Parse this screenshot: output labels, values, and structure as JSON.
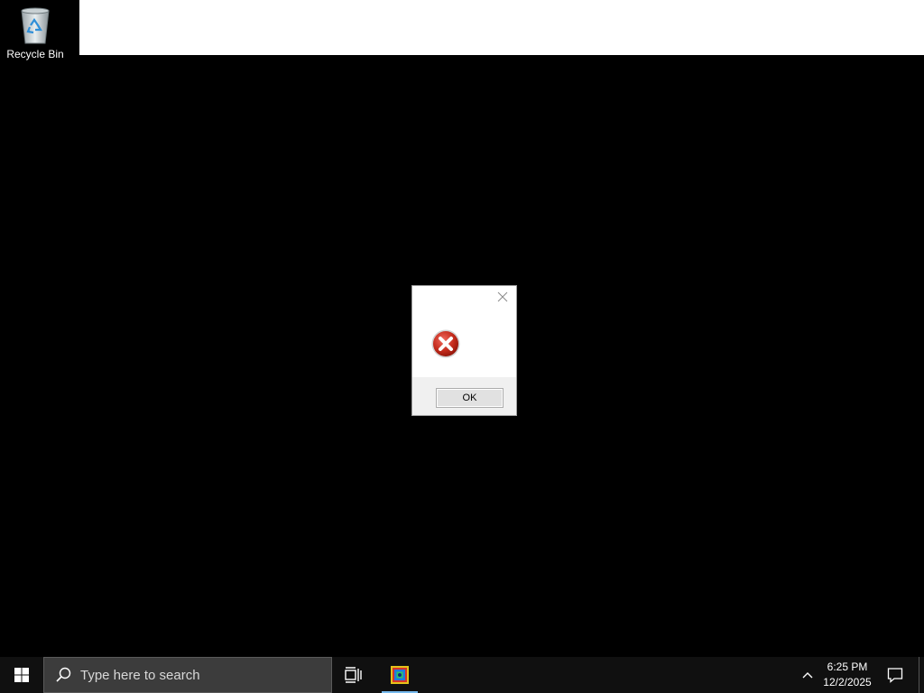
{
  "desktop": {
    "icons": [
      {
        "label": "Recycle Bin",
        "icon": "recycle-bin-icon"
      }
    ]
  },
  "dialog": {
    "icon": "error-icon",
    "message": "",
    "ok_label": "OK",
    "close_icon": "close-icon"
  },
  "taskbar": {
    "start_icon": "windows-start-icon",
    "search_placeholder": "Type here to search",
    "task_view_icon": "task-view-icon",
    "pinned_apps": [
      {
        "icon": "app-icon",
        "active": true
      }
    ],
    "tray": {
      "chevron_icon": "chevron-up-icon",
      "time": "6:25 PM",
      "date": "12/2/2025",
      "notification_icon": "action-center-icon"
    }
  },
  "colors": {
    "desktop_bg": "#000000",
    "taskbar_bg": "#101010",
    "search_bg": "#3c3c3c",
    "active_underline": "#76b9ed",
    "error_red": "#c42b1c"
  }
}
